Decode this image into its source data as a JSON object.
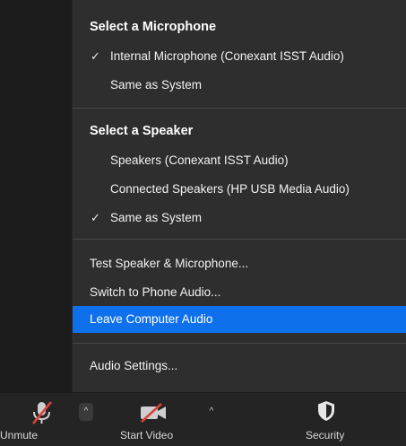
{
  "menu": {
    "microphone": {
      "title": "Select a Microphone",
      "items": [
        {
          "label": "Internal Microphone (Conexant ISST Audio)",
          "checked": true
        },
        {
          "label": "Same as System",
          "checked": false
        }
      ]
    },
    "speaker": {
      "title": "Select a Speaker",
      "items": [
        {
          "label": "Speakers (Conexant ISST Audio)",
          "checked": false
        },
        {
          "label": "Connected Speakers (HP USB Media Audio)",
          "checked": false
        },
        {
          "label": "Same as System",
          "checked": true
        }
      ]
    },
    "actions": [
      {
        "label": "Test Speaker & Microphone..."
      },
      {
        "label": "Switch to Phone Audio..."
      },
      {
        "label": "Leave Computer Audio",
        "highlighted": true
      }
    ],
    "settings": {
      "label": "Audio Settings..."
    },
    "check_glyph": "✓"
  },
  "toolbar": {
    "unmute": {
      "label": "Unmute",
      "icon": "microphone-muted-icon"
    },
    "start_video": {
      "label": "Start Video",
      "icon": "video-off-icon"
    },
    "security": {
      "label": "Security",
      "icon": "shield-icon"
    },
    "caret_up": "^"
  },
  "colors": {
    "menu_bg": "#2e2e2e",
    "highlight": "#0e71eb",
    "muted_red": "#d9433b",
    "toolbar_bg": "#242424"
  }
}
